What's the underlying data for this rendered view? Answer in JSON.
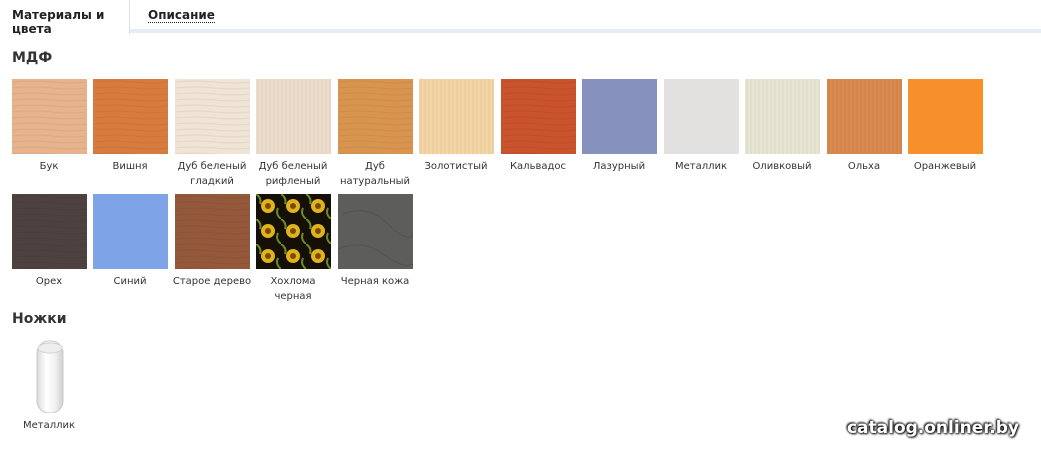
{
  "tabs": {
    "active": "Материалы и цвета",
    "other": "Описание"
  },
  "sections": {
    "mdf": {
      "title": "МДФ",
      "items": [
        {
          "label": "Бук"
        },
        {
          "label": "Вишня"
        },
        {
          "label": "Дуб беленый\nгладкий"
        },
        {
          "label": "Дуб беленый\nрифленый"
        },
        {
          "label": "Дуб\nнатуральный"
        },
        {
          "label": "Золотистый"
        },
        {
          "label": "Кальвадос"
        },
        {
          "label": "Лазурный"
        },
        {
          "label": "Металлик"
        },
        {
          "label": "Оливковый"
        },
        {
          "label": "Ольха"
        },
        {
          "label": "Оранжевый"
        },
        {
          "label": "Орех"
        },
        {
          "label": "Синий"
        },
        {
          "label": "Старое дерево"
        },
        {
          "label": "Хохлома\nчерная"
        },
        {
          "label": "Черная кожа"
        }
      ]
    },
    "legs": {
      "title": "Ножки",
      "items": [
        {
          "label": "Металлик"
        }
      ]
    }
  },
  "watermark": "catalog.onliner.by"
}
